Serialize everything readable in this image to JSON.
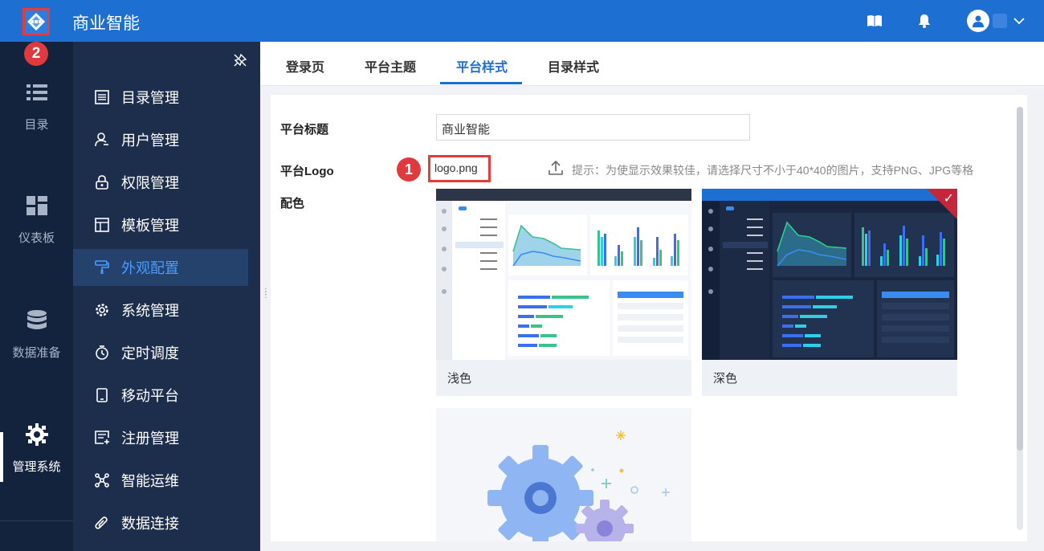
{
  "app": {
    "title": "商业智能"
  },
  "annotations": {
    "badge_1": "1",
    "badge_2": "2"
  },
  "left_nav": [
    {
      "label": "目录",
      "icon": "list-icon"
    },
    {
      "label": "仪表板",
      "icon": "dashboard-icon"
    },
    {
      "label": "数据准备",
      "icon": "database-icon"
    },
    {
      "label": "管理系统",
      "icon": "gear-icon",
      "active": true
    }
  ],
  "sidebar": {
    "items": [
      {
        "label": "目录管理",
        "icon": "catalog-icon"
      },
      {
        "label": "用户管理",
        "icon": "user-icon"
      },
      {
        "label": "权限管理",
        "icon": "lock-icon"
      },
      {
        "label": "模板管理",
        "icon": "template-icon"
      },
      {
        "label": "外观配置",
        "icon": "paint-roller-icon",
        "active": true
      },
      {
        "label": "系统管理",
        "icon": "settings-icon"
      },
      {
        "label": "定时调度",
        "icon": "timer-icon"
      },
      {
        "label": "移动平台",
        "icon": "mobile-icon"
      },
      {
        "label": "注册管理",
        "icon": "register-icon"
      },
      {
        "label": "智能运维",
        "icon": "network-icon"
      },
      {
        "label": "数据连接",
        "icon": "paperclip-icon"
      }
    ]
  },
  "tabs": [
    {
      "label": "登录页"
    },
    {
      "label": "平台主题"
    },
    {
      "label": "平台样式",
      "active": true
    },
    {
      "label": "目录样式"
    }
  ],
  "form": {
    "title_label": "平台标题",
    "title_value": "商业智能",
    "logo_label": "平台Logo",
    "logo_file": "logo.png",
    "logo_hint": "提示：为使显示效果较佳，请选择尺寸不小于40*40的图片，支持PNG、JPG等格",
    "color_label": "配色",
    "themes": [
      {
        "name": "浅色",
        "selected": false
      },
      {
        "name": "深色",
        "selected": true
      }
    ]
  },
  "colors": {
    "topbar": "#1e6fd2",
    "leftnav": "#13233d",
    "sidebar": "#1c2e4c",
    "accent": "#1e6fd2",
    "annotation_red": "#e0393e"
  }
}
